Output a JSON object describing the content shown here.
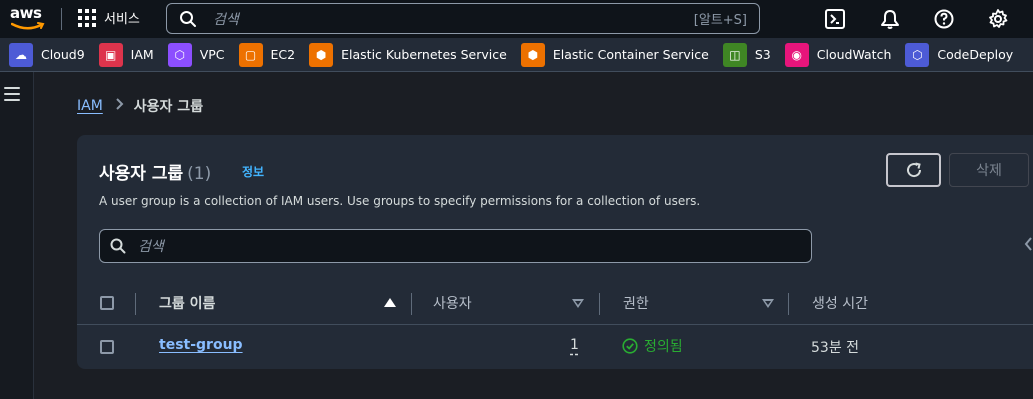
{
  "topnav": {
    "logo_text": "aws",
    "services_label": "서비스",
    "search_placeholder": "검색",
    "search_shortcut": "[알트+S]",
    "icons": [
      "cloudshell-icon",
      "bell-icon",
      "help-icon",
      "settings-icon"
    ]
  },
  "favorites": [
    {
      "label": "Cloud9",
      "icon": "cloud9-icon",
      "color": "#4d5bd6"
    },
    {
      "label": "IAM",
      "icon": "iam-icon",
      "color": "#dd344c"
    },
    {
      "label": "VPC",
      "icon": "vpc-icon",
      "color": "#8c4fff"
    },
    {
      "label": "EC2",
      "icon": "ec2-icon",
      "color": "#ed7100"
    },
    {
      "label": "Elastic Kubernetes Service",
      "icon": "eks-icon",
      "color": "#ed7100"
    },
    {
      "label": "Elastic Container Service",
      "icon": "ecs-icon",
      "color": "#ed7100"
    },
    {
      "label": "S3",
      "icon": "s3-icon",
      "color": "#3f8624"
    },
    {
      "label": "CloudWatch",
      "icon": "cloudwatch-icon",
      "color": "#e7157b"
    },
    {
      "label": "CodeDeploy",
      "icon": "codedeploy-icon",
      "color": "#4d5bd6"
    }
  ],
  "breadcrumb": {
    "root": "IAM",
    "current": "사용자 그룹"
  },
  "panel": {
    "title": "사용자 그룹",
    "count": "(1)",
    "info": "정보",
    "description": "A user group is a collection of IAM users. Use groups to specify permissions for a collection of users.",
    "delete_label": "삭제",
    "filter_placeholder": "검색"
  },
  "table": {
    "columns": [
      "그룹 이름",
      "사용자",
      "권한",
      "생성 시간"
    ],
    "rows": [
      {
        "name": "test-group",
        "users": "1",
        "permissions": "정의됨",
        "created": "53분 전"
      }
    ]
  },
  "colors": {
    "link": "#89bdff",
    "success": "#29ad32",
    "background": "#1b1e24",
    "panel": "#232b37"
  }
}
